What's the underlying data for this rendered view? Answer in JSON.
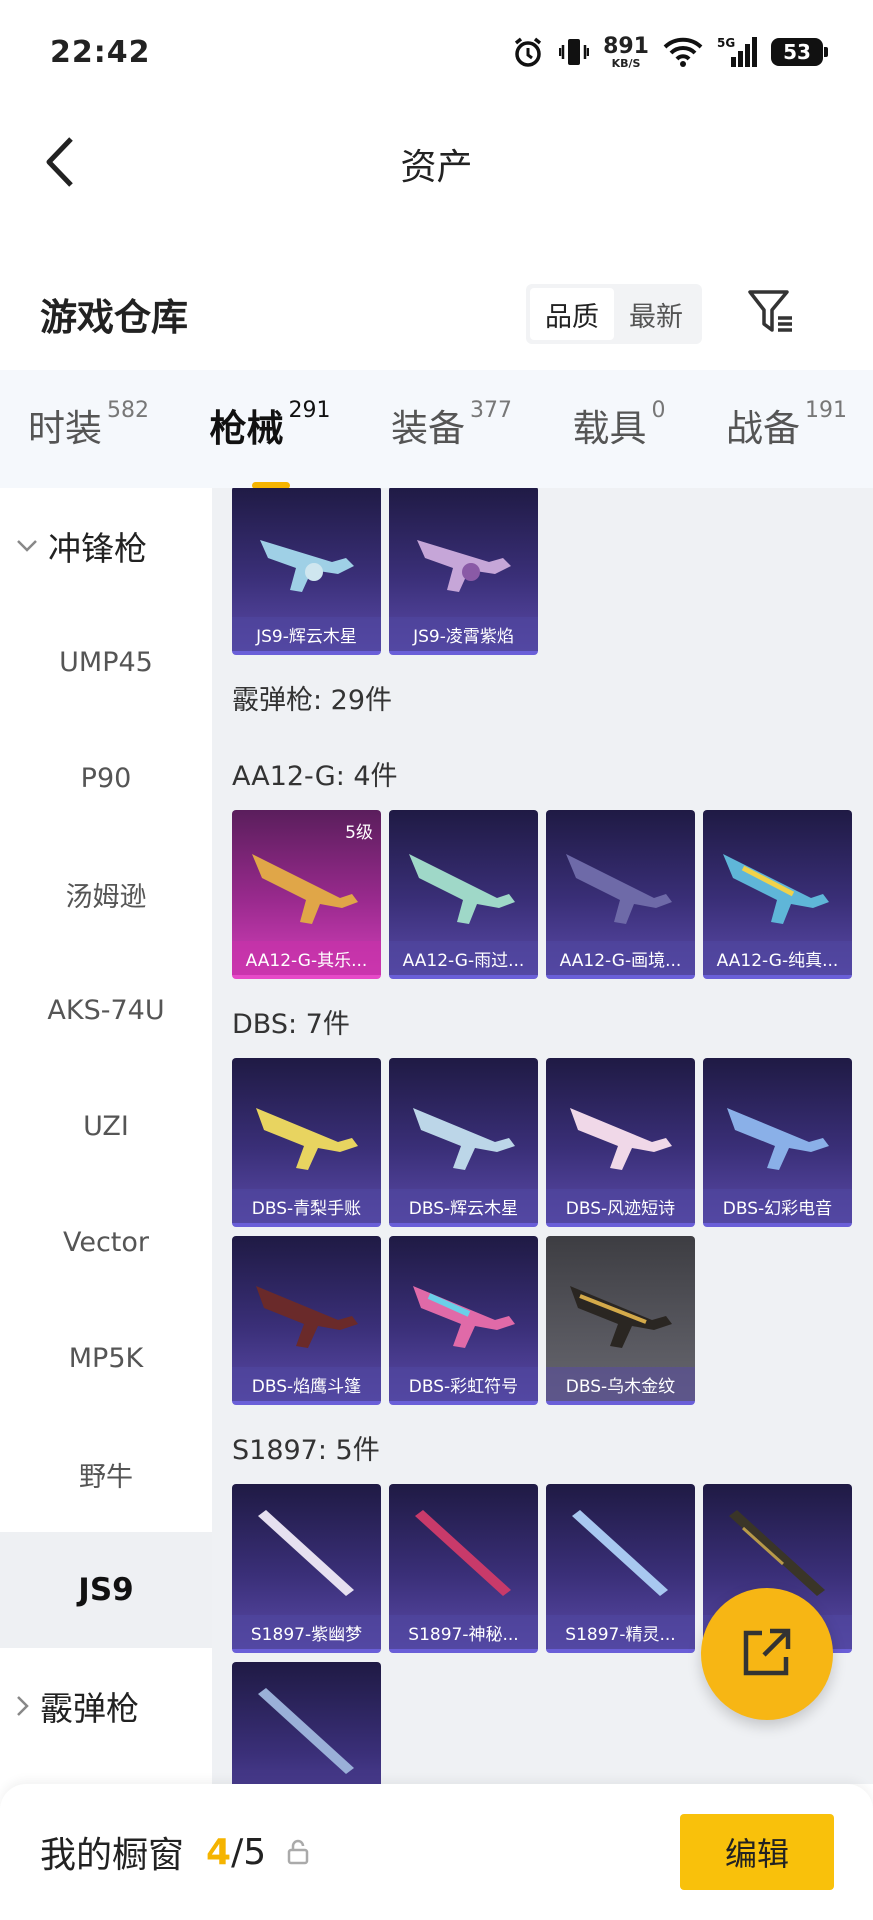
{
  "status_bar": {
    "time": "22:42",
    "net_speed_value": "891",
    "net_speed_unit": "KB/S",
    "battery": "53",
    "icons": [
      "alarm-icon",
      "vibrate-icon",
      "wifi-icon",
      "5g-signal-icon",
      "battery-icon"
    ]
  },
  "header": {
    "title": "资产",
    "back_icon": "chevron-left-icon"
  },
  "warehouse": {
    "title": "游戏仓库",
    "sort_options": [
      "品质",
      "最新"
    ],
    "sort_selected": "品质",
    "filter_icon": "filter-icon"
  },
  "tabs": [
    {
      "label": "时装",
      "count": "582",
      "active": false
    },
    {
      "label": "枪械",
      "count": "291",
      "active": true
    },
    {
      "label": "装备",
      "count": "377",
      "active": false
    },
    {
      "label": "载具",
      "count": "0",
      "active": false
    },
    {
      "label": "战备",
      "count": "191",
      "active": false
    }
  ],
  "sidebar": {
    "group1": "冲锋枪",
    "items": [
      "UMP45",
      "P90",
      "汤姆逊",
      "AKS-74U",
      "UZI",
      "Vector",
      "MP5K",
      "野牛",
      "JS9"
    ],
    "selected": "JS9",
    "group2": "霰弹枪"
  },
  "content": {
    "js9_items": [
      "JS9-辉云木星",
      "JS9-凌霄紫焰"
    ],
    "shotgun_total": "霰弹枪: 29件",
    "aa12": {
      "label": "AA12-G: 4件",
      "items": [
        {
          "name": "AA12-G-其乐...",
          "level": "5级"
        },
        {
          "name": "AA12-G-雨过..."
        },
        {
          "name": "AA12-G-画境..."
        },
        {
          "name": "AA12-G-纯真..."
        }
      ]
    },
    "dbs": {
      "label": "DBS: 7件",
      "items": [
        "DBS-青梨手账",
        "DBS-辉云木星",
        "DBS-风迹短诗",
        "DBS-幻彩电音",
        "DBS-焰鹰斗篷",
        "DBS-彩虹符号",
        "DBS-乌木金纹"
      ]
    },
    "s1897": {
      "label": "S1897: 5件",
      "items": [
        "S1897-紫幽梦",
        "S1897-神秘...",
        "S1897-精灵...",
        ""
      ]
    }
  },
  "fab": {
    "icon": "share-external-icon"
  },
  "bottom_bar": {
    "label": "我的橱窗",
    "current": "4",
    "separator": "/",
    "total": "5",
    "lock_icon": "lock-icon",
    "edit_label": "编辑"
  },
  "colors": {
    "accent": "#f5b400",
    "edit_button": "#f9c10b",
    "card_purple": "#3a2f78",
    "card_legend": "#9a2a8e"
  }
}
